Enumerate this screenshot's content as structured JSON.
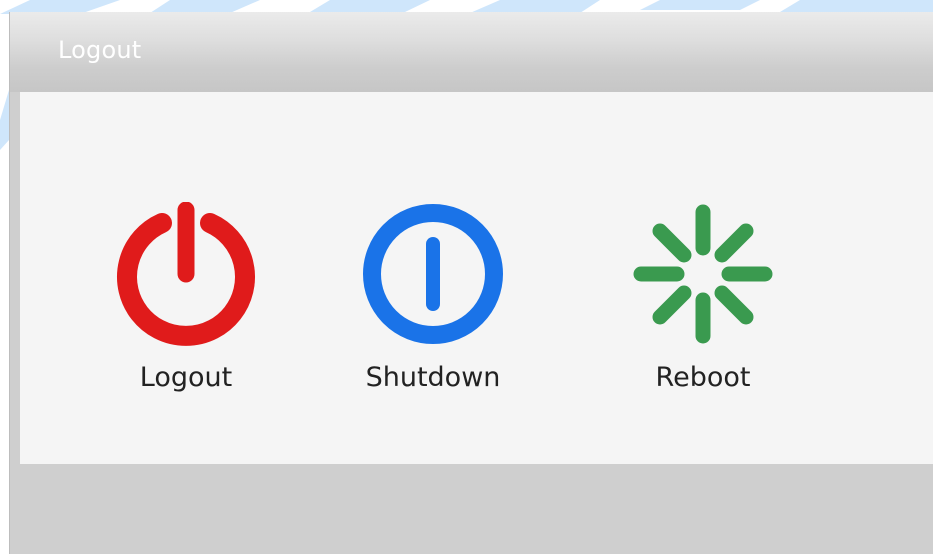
{
  "window": {
    "title": "Logout"
  },
  "actions": [
    {
      "label": "Logout",
      "icon": "power-icon",
      "color": "#e01b1b"
    },
    {
      "label": "Shutdown",
      "icon": "power-icon",
      "color": "#1a73e8"
    },
    {
      "label": "Reboot",
      "icon": "loading-spinner-icon",
      "color": "#3a9a4f"
    }
  ],
  "theme": {
    "title_bar": "#d4d4d4",
    "panel": "#f5f5f5",
    "frame": "#cfcfcf",
    "watermark": "#cfe6fb"
  }
}
